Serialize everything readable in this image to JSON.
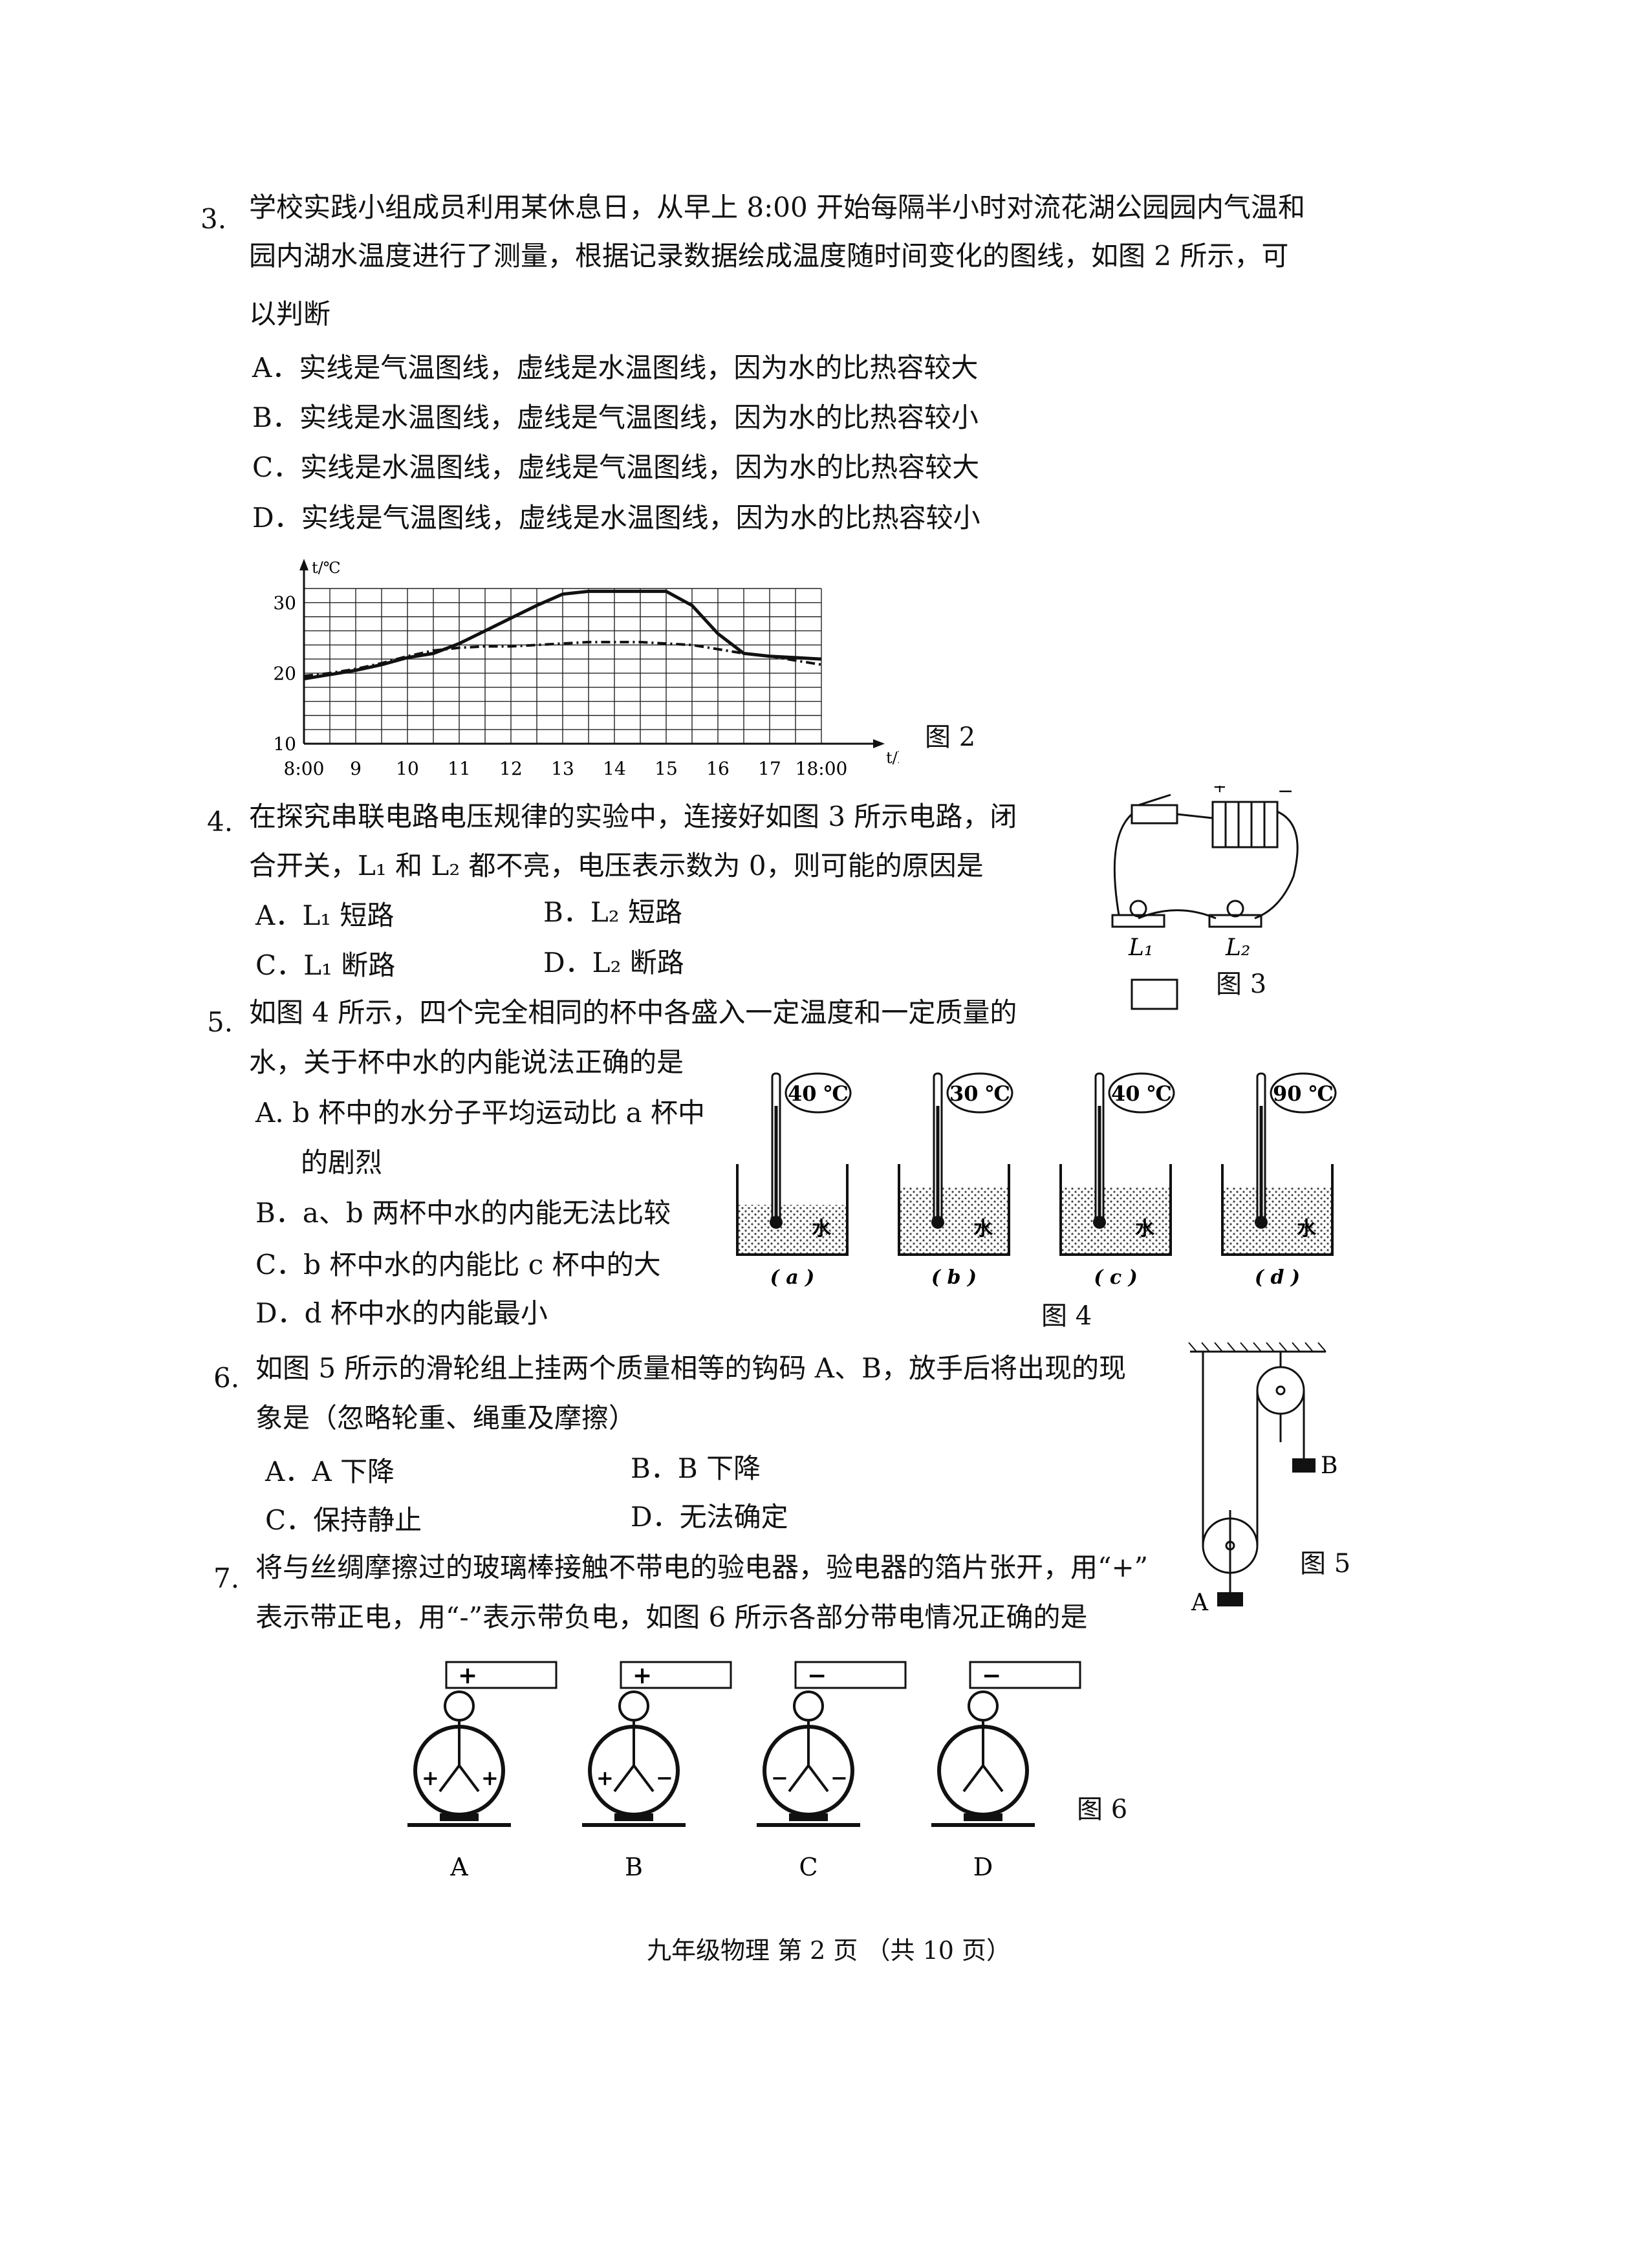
{
  "q3": {
    "number": "3.",
    "lines": [
      "学校实践小组成员利用某休息日，从早上 8:00 开始每隔半小时对流花湖公园园内气温和",
      "园内湖水温度进行了测量，根据记录数据绘成温度随时间变化的图线，如图 2 所示，可",
      "以判断"
    ],
    "options": [
      "A．实线是气温图线，虚线是水温图线，因为水的比热容较大",
      "B．实线是水温图线，虚线是气温图线，因为水的比热容较小",
      "C．实线是水温图线，虚线是气温图线，因为水的比热容较大",
      "D．实线是气温图线，虚线是水温图线，因为水的比热容较小"
    ],
    "figure_caption": "图 2"
  },
  "chart_data": {
    "type": "line",
    "title": "",
    "ylabel": "t/℃",
    "xlabel": "t/h",
    "x_ticks": [
      "8:00",
      "9",
      "10",
      "11",
      "12",
      "13",
      "14",
      "15",
      "16",
      "17",
      "18:00"
    ],
    "y_ticks": [
      "10",
      "20",
      "30"
    ],
    "xlim": [
      8,
      18
    ],
    "ylim": [
      10,
      32
    ],
    "grid": true,
    "series": [
      {
        "style": "solid",
        "x": [
          8,
          8.5,
          9,
          9.5,
          10,
          10.5,
          11,
          11.5,
          12,
          12.5,
          13,
          13.5,
          14,
          14.5,
          15,
          15.5,
          16,
          16.5,
          17,
          17.5,
          18
        ],
        "y": [
          19.2,
          19.8,
          20.4,
          21.2,
          22.2,
          22.8,
          24.2,
          26.0,
          27.8,
          29.6,
          31.2,
          31.6,
          31.6,
          31.6,
          31.6,
          29.6,
          25.6,
          22.8,
          22.4,
          22.2,
          22.0
        ]
      },
      {
        "style": "dashed",
        "x": [
          8,
          8.5,
          9,
          9.5,
          10,
          10.5,
          11,
          11.5,
          12,
          12.5,
          13,
          13.5,
          14,
          14.5,
          15,
          15.5,
          16,
          16.5,
          17,
          17.5,
          18
        ],
        "y": [
          19.6,
          20.0,
          20.6,
          21.4,
          22.4,
          23.2,
          23.6,
          23.8,
          23.8,
          24.0,
          24.2,
          24.4,
          24.4,
          24.4,
          24.2,
          24.0,
          23.4,
          22.8,
          22.4,
          21.8,
          21.2
        ]
      }
    ]
  },
  "q4": {
    "number": "4.",
    "lines": [
      "在探究串联电路电压规律的实验中，连接好如图 3 所示电路，闭",
      "合开关，L₁ 和 L₂ 都不亮，电压表示数为 0，则可能的原因是"
    ],
    "options": [
      "A．L₁ 短路",
      "B．L₂ 短路",
      "C．L₁ 断路",
      "D．L₂ 断路"
    ],
    "figure_caption": "图 3",
    "fig_labels": [
      "L₁",
      "L₂"
    ]
  },
  "q5": {
    "number": "5.",
    "lines": [
      "如图 4 所示，四个完全相同的杯中各盛入一定温度和一定质量的",
      "水，关于杯中水的内能说法正确的是"
    ],
    "options": [
      "A. b 杯中的水分子平均运动比 a 杯中",
      "的剧烈",
      "B．a、b 两杯中水的内能无法比较",
      "C．b 杯中水的内能比 c 杯中的大",
      "D．d 杯中水的内能最小"
    ],
    "figure_caption": "图 4",
    "cups": [
      {
        "temp": "40 ℃",
        "label": "( a )",
        "water": "水",
        "level": 0.55
      },
      {
        "temp": "30 ℃",
        "label": "( b )",
        "water": "水",
        "level": 0.75
      },
      {
        "temp": "40 ℃",
        "label": "( c )",
        "water": "水",
        "level": 0.75
      },
      {
        "temp": "90 ℃",
        "label": "( d )",
        "water": "水",
        "level": 0.75
      }
    ]
  },
  "q6": {
    "number": "6.",
    "lines": [
      "如图 5 所示的滑轮组上挂两个质量相等的钩码 A、B，放手后将出现的现",
      "象是（忽略轮重、绳重及摩擦）"
    ],
    "options": [
      "A．A 下降",
      "B．B 下降",
      "C．保持静止",
      "D．无法确定"
    ],
    "figure_caption": "图 5",
    "fig_labels": [
      "A",
      "B"
    ]
  },
  "q7": {
    "number": "7.",
    "lines": [
      "将与丝绸摩擦过的玻璃棒接触不带电的验电器，验电器的箔片张开，用“+”",
      "表示带正电，用“-”表示带负电，如图 6 所示各部分带电情况正确的是"
    ],
    "figure_caption": "图 6",
    "electroscopes": [
      {
        "label": "A",
        "top": "+",
        "left": "+",
        "right": "+"
      },
      {
        "label": "B",
        "top": "+",
        "left": "+",
        "right": "−"
      },
      {
        "label": "C",
        "top": "−",
        "left": "−",
        "right": "−"
      },
      {
        "label": "D",
        "top": "−",
        "left": "",
        "right": ""
      }
    ]
  },
  "footer": "九年级物理   第 2 页 （共 10 页）"
}
